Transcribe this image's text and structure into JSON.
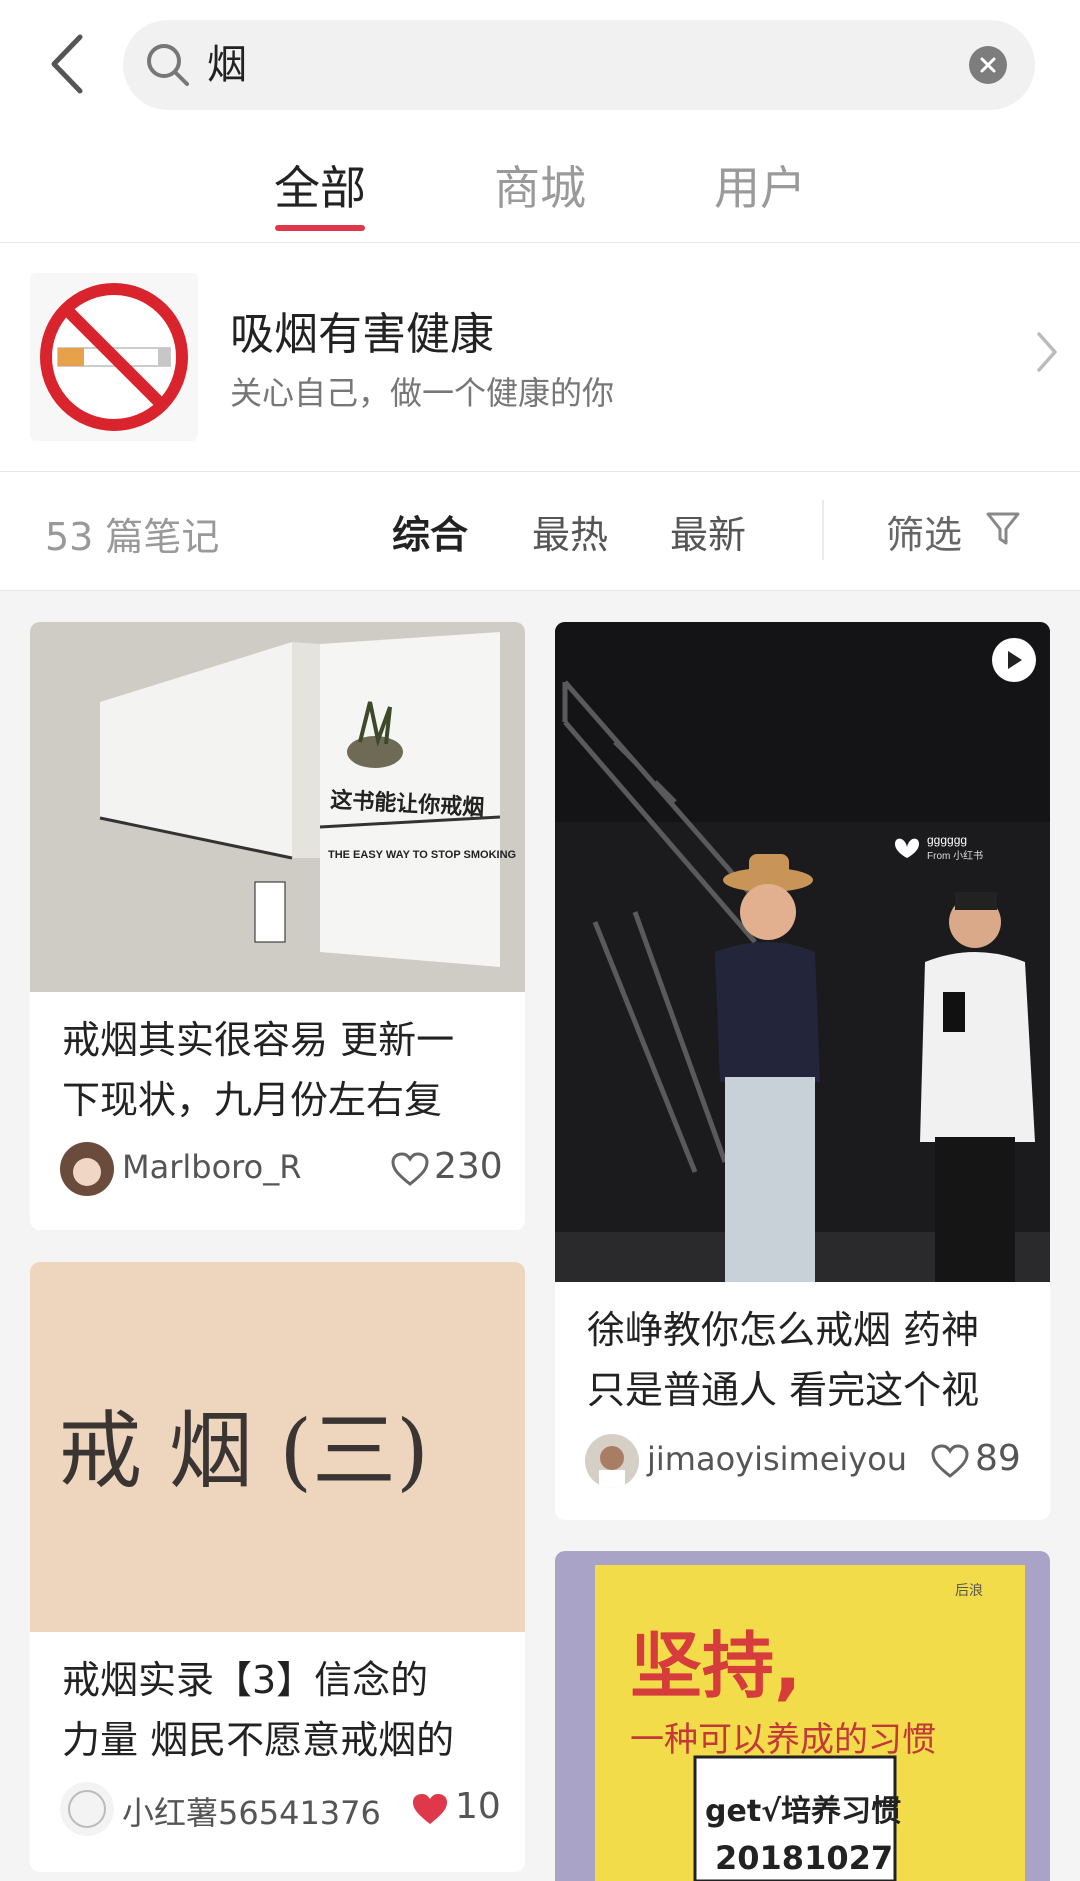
{
  "search": {
    "query": "烟"
  },
  "tabs": [
    {
      "label": "全部"
    },
    {
      "label": "商城"
    },
    {
      "label": "用户"
    }
  ],
  "banner": {
    "title": "吸烟有害健康",
    "subtitle": "关心自己，做一个健康的你",
    "icon": "no-smoking-icon"
  },
  "sortbar": {
    "count": "53 篇笔记",
    "sorts": [
      "综合",
      "最热",
      "最新"
    ],
    "active_sort": "综合",
    "filter_label": "筛选"
  },
  "notes": [
    {
      "title_line1": "戒烟其实很容易 更新一",
      "title_line2": "下现状，九月份左右复",
      "author": "Marlboro_R",
      "likes": "230",
      "liked": false,
      "book_title_cn": "这书能让你戒烟",
      "book_title_en": "THE EASY WAY TO STOP SMOKING"
    },
    {
      "title_line1": "徐峥教你怎么戒烟 药神",
      "title_line2": "只是普通人 看完这个视",
      "author": "jimaoyisimeiyou",
      "likes": "89",
      "liked": false,
      "watermark": "gggggg",
      "watermark_sub": "From 小红书"
    },
    {
      "title_line1": "戒烟实录【3】信念的",
      "title_line2": "力量 烟民不愿意戒烟的",
      "author": "小红薯56541376",
      "likes": "10",
      "liked": true,
      "handwriting": "戒 烟 (三)"
    },
    {
      "poster_main": "坚持,",
      "poster_sub": "一种可以养成的习惯",
      "sticker_line1": "get√培养习惯",
      "sticker_line2": "20181027",
      "brand": "后浪"
    }
  ],
  "colors": {
    "accent": "#e0384b",
    "bg": "#f4f4f4"
  }
}
